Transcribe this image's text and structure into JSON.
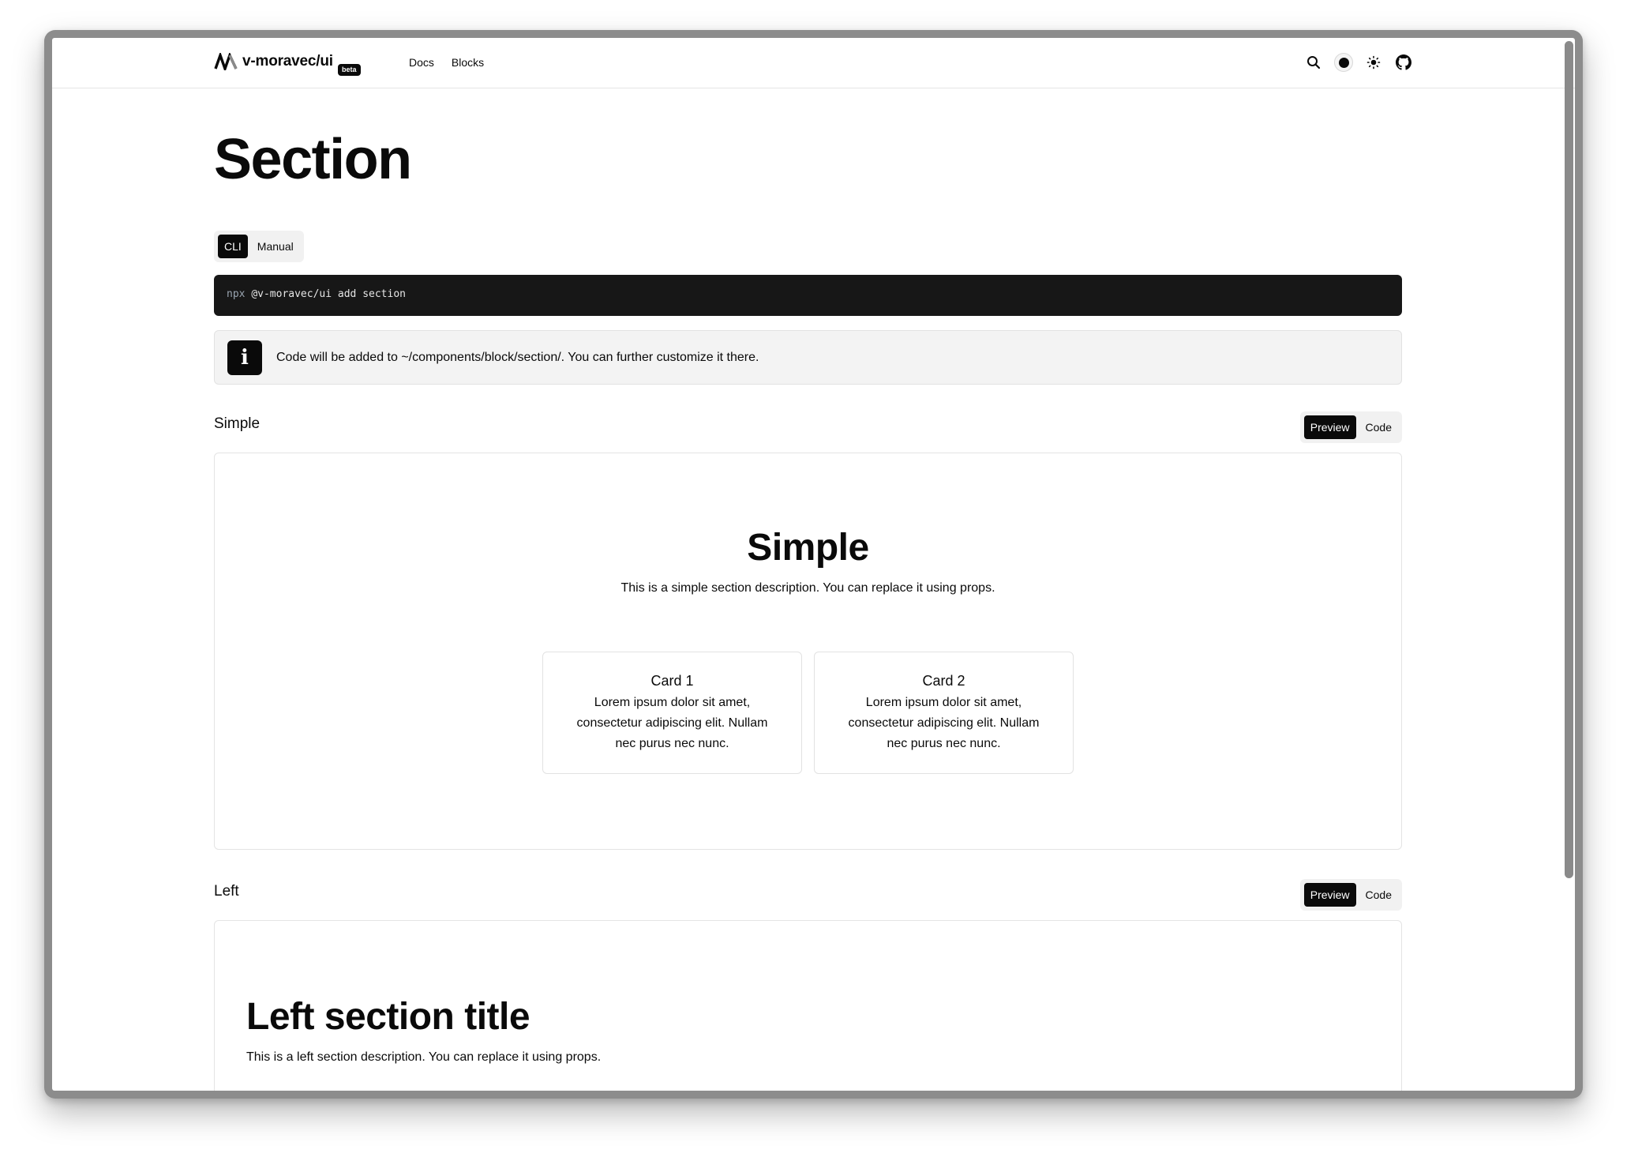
{
  "header": {
    "brand_name": "v-moravec/ui",
    "beta_label": "beta",
    "nav": [
      "Docs",
      "Blocks"
    ],
    "tools": [
      "search-icon",
      "theme-color-toggle",
      "sun-icon",
      "github-icon"
    ]
  },
  "page": {
    "title": "Section",
    "install_tabs": [
      "CLI",
      "Manual"
    ],
    "install_active": "CLI",
    "command_prefix": "npx",
    "command_rest": "@v-moravec/ui add section",
    "alert_text": "Code will be added to ~/components/block/section/. You can further customize it there."
  },
  "examples": [
    {
      "label": "Simple",
      "tabs": [
        "Preview",
        "Code"
      ],
      "active": "Preview",
      "title": "Simple",
      "description": "This is a simple section description. You can replace it using props.",
      "cards": [
        {
          "title": "Card 1",
          "body": "Lorem ipsum dolor sit amet, consectetur adipiscing elit. Nullam nec purus nec nunc."
        },
        {
          "title": "Card 2",
          "body": "Lorem ipsum dolor sit amet, consectetur adipiscing elit. Nullam nec purus nec nunc."
        }
      ]
    },
    {
      "label": "Left",
      "tabs": [
        "Preview",
        "Code"
      ],
      "active": "Preview",
      "title": "Left section title",
      "description": "This is a left section description. You can replace it using props."
    }
  ],
  "colors": {
    "accent": "#0a0a0a",
    "code_bg": "#171717",
    "alert_bg": "#f3f3f3",
    "border": "#e4e4e4"
  }
}
